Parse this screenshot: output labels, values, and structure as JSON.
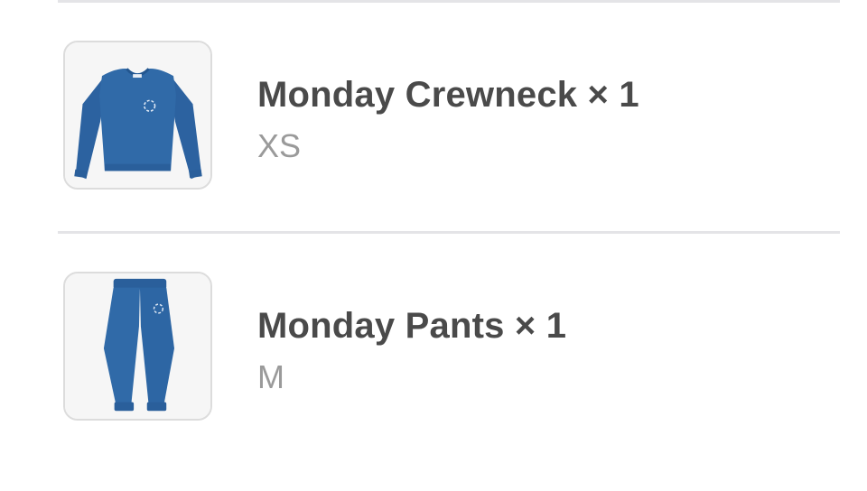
{
  "order_items": [
    {
      "name": "Monday Crewneck × 1",
      "variant": "XS",
      "image_icon": "blue-crewneck-sweatshirt",
      "color": "#2f68a6"
    },
    {
      "name": "Monday Pants × 1",
      "variant": "M",
      "image_icon": "blue-sweatpants",
      "color": "#2f68a6"
    }
  ],
  "colors": {
    "divider": "#e4e4e7",
    "name_text": "#4a4a4a",
    "variant_text": "#9a9a9a",
    "garment_blue": "#2f68a6"
  }
}
